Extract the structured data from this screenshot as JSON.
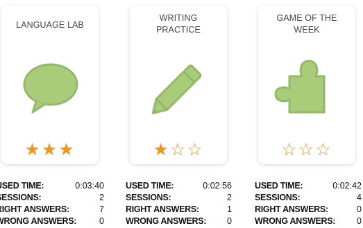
{
  "cards": [
    {
      "title": "LANGUAGE LAB",
      "icon": "speech-bubble-icon",
      "rating": 3,
      "stars": [
        "★",
        "★",
        "★"
      ],
      "stats": {
        "used_time_label": "USED TIME:",
        "used_time": "0:03:40",
        "sessions_label": "SESSIONS:",
        "sessions": "2",
        "right_label": "RIGHT ANSWERS:",
        "right": "7",
        "wrong_label": "WRONG ANSWERS:",
        "wrong": "0"
      }
    },
    {
      "title": "WRITING PRACTICE",
      "icon": "pencil-icon",
      "rating": 1,
      "stars": [
        "★",
        "☆",
        "☆"
      ],
      "stats": {
        "used_time_label": "USED TIME:",
        "used_time": "0:02:56",
        "sessions_label": "SESSIONS:",
        "sessions": "2",
        "right_label": "RIGHT ANSWERS:",
        "right": "1",
        "wrong_label": "WRONG ANSWERS:",
        "wrong": "0"
      }
    },
    {
      "title": "GAME OF THE WEEK",
      "icon": "puzzle-piece-icon",
      "rating": 0,
      "stars": [
        "☆",
        "☆",
        "☆"
      ],
      "stats": {
        "used_time_label": "USED TIME:",
        "used_time": "0:02:42",
        "sessions_label": "SESSIONS:",
        "sessions": "4",
        "right_label": "RIGHT ANSWERS:",
        "right": "0",
        "wrong_label": "WRONG ANSWERS:",
        "wrong": "0"
      }
    }
  ],
  "colors": {
    "icon_fill": "#a8cc7a",
    "icon_stroke": "#93b868",
    "star": "#f0951e"
  }
}
